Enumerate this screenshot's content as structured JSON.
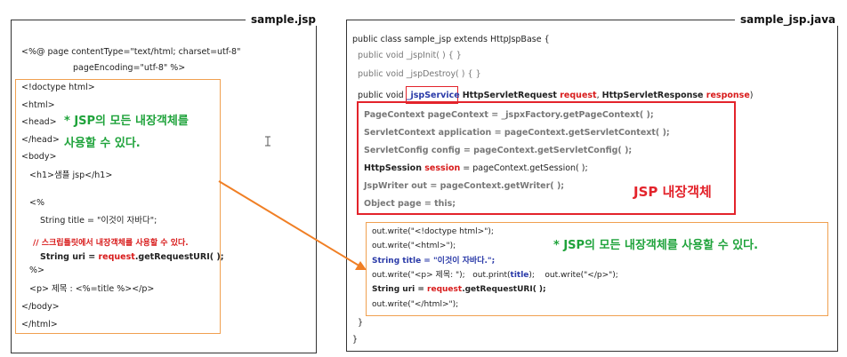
{
  "left_panel": {
    "title": "sample.jsp",
    "directive_line1": "<%@ page contentType=\"text/html; charset=utf-8\"",
    "directive_line2": "pageEncoding=\"utf-8\" %>",
    "lines": {
      "doctype": "<!doctype html>",
      "html_open": "<html>",
      "head_open": "<head>",
      "head_close": "</head>",
      "body_open": "<body>",
      "h1": "<h1>샘플 jsp</h1>",
      "scriptlet_open": "<%",
      "string_title": "String title = \"이것이 자바다\";",
      "comment": "// 스크립틀릿에서 내장객체를 사용할 수 있다.",
      "uri_prefix": "String uri = ",
      "uri_request": "request",
      "uri_suffix": ".getRequestURI( );",
      "scriptlet_close": "%>",
      "p_line": "<p> 제목 : <%=title %></p>",
      "body_close": "</body>",
      "html_close": "</html>"
    },
    "note": "* JSP의 모든 내장객체를\n사용할 수 있다."
  },
  "right_panel": {
    "title": "sample_jsp.java",
    "class_decl": "public class sample_jsp extends HttpJspBase {",
    "jspinit": "public void _jspInit( ) { }",
    "jspdestroy": "public void _jspDestroy( ) { }",
    "service_prefix": "public void ",
    "service_name": "_jspService",
    "service_arg1_type": "HttpServletRequest ",
    "service_arg1_name": "request",
    "service_sep": ", ",
    "service_arg2_type": "HttpServletResponse ",
    "service_arg2_name": "response",
    "service_close": ")",
    "implicit_objects": {
      "pagecontext": "PageContext pageContext = _jspxFactory.getPageContext( );",
      "application": "ServletContext application = pageContext.getServletContext( );",
      "config": "ServletConfig config = pageContext.getServletConfig( );",
      "session_type": "HttpSession ",
      "session_name": "session",
      "session_rest": " = pageContext.getSession( );",
      "out": "JspWriter out = pageContext.getWriter( );",
      "page": "Object page = this;"
    },
    "implicit_label": "JSP 내장객체",
    "output_lines": {
      "l1": "out.write(\"<!doctype html>\");",
      "l2": "out.write(\"<html>\");",
      "l3": "String title = \"이것이 자바다.\";",
      "l4a": "out.write(\"<p> 제목: \");",
      "l4b": "out.print(",
      "l4c": "title",
      "l4d": ");",
      "l4e": "out.write(\"</p>\");",
      "l5_prefix": "String uri = ",
      "l5_request": "request",
      "l5_suffix": ".getRequestURI( );",
      "l6": "out.write(\"</html>\");"
    },
    "note": "* JSP의 모든 내장객체를 사용할 수 있다.",
    "brace_inner": "}",
    "brace_outer": "}"
  },
  "colors": {
    "red": "#e3232b",
    "orange": "#f0a050",
    "green": "#1fa33b",
    "blue": "#2a3aa8",
    "arrow": "#f07f25"
  },
  "cursor_icon": "text-cursor-icon"
}
